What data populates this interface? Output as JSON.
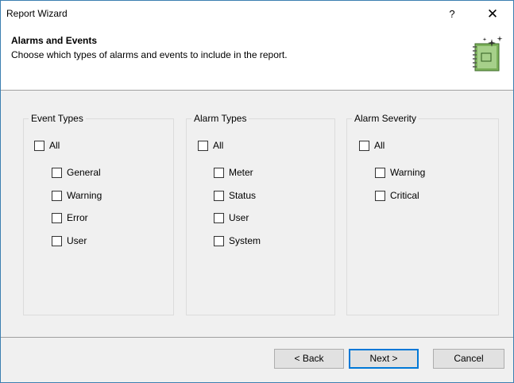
{
  "window": {
    "title": "Report Wizard",
    "help": "?",
    "close": "✕"
  },
  "header": {
    "title": "Alarms and Events",
    "subtitle": "Choose which types of alarms and events to include in the report.",
    "icon": "wizard-notebook-icon"
  },
  "groups": [
    {
      "label": "Event Types",
      "all": "All",
      "items": [
        "General",
        "Warning",
        "Error",
        "User"
      ]
    },
    {
      "label": "Alarm Types",
      "all": "All",
      "items": [
        "Meter",
        "Status",
        "User",
        "System"
      ]
    },
    {
      "label": "Alarm Severity",
      "all": "All",
      "items": [
        "Warning",
        "Critical"
      ]
    }
  ],
  "buttons": {
    "back": "< Back",
    "next": "Next >",
    "cancel": "Cancel"
  },
  "colors": {
    "window_border": "#3c7fb1",
    "default_button_border": "#0078d7",
    "icon_green": "#7cb15a"
  }
}
